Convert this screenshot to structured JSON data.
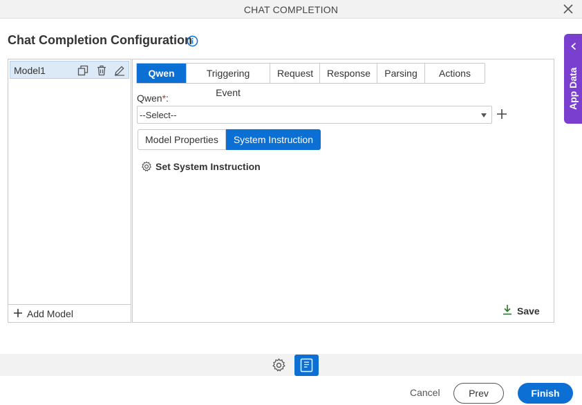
{
  "window": {
    "title": "CHAT COMPLETION",
    "close_icon": "close-icon"
  },
  "page": {
    "heading": "Chat Completion Configuration",
    "info_icon": "info-icon"
  },
  "models": {
    "items": [
      {
        "name": "Model1"
      }
    ],
    "icons": [
      "copy-icon",
      "delete-icon",
      "edit-icon"
    ],
    "add_label": "Add Model"
  },
  "tabs": [
    {
      "label": "Qwen",
      "active": true
    },
    {
      "label": "Triggering Event",
      "active": false
    },
    {
      "label": "Request",
      "active": false
    },
    {
      "label": "Response",
      "active": false
    },
    {
      "label": "Parsing",
      "active": false
    },
    {
      "label": "Actions",
      "active": false
    }
  ],
  "form": {
    "qwen_label": "Qwen",
    "required_mark": "*",
    "label_suffix": ":",
    "select_value": "--Select--"
  },
  "subtabs": [
    {
      "label": "Model Properties",
      "active": false
    },
    {
      "label": "System Instruction",
      "active": true
    }
  ],
  "system_instruction": {
    "link_label": "Set System Instruction"
  },
  "save_label": "Save",
  "side_panel": {
    "label": "App Data"
  },
  "footer": {
    "cancel": "Cancel",
    "prev": "Prev",
    "finish": "Finish"
  },
  "colors": {
    "primary": "#0b6fd3",
    "side_tab": "#7b3fd0",
    "selected_row": "#dce9f7"
  }
}
